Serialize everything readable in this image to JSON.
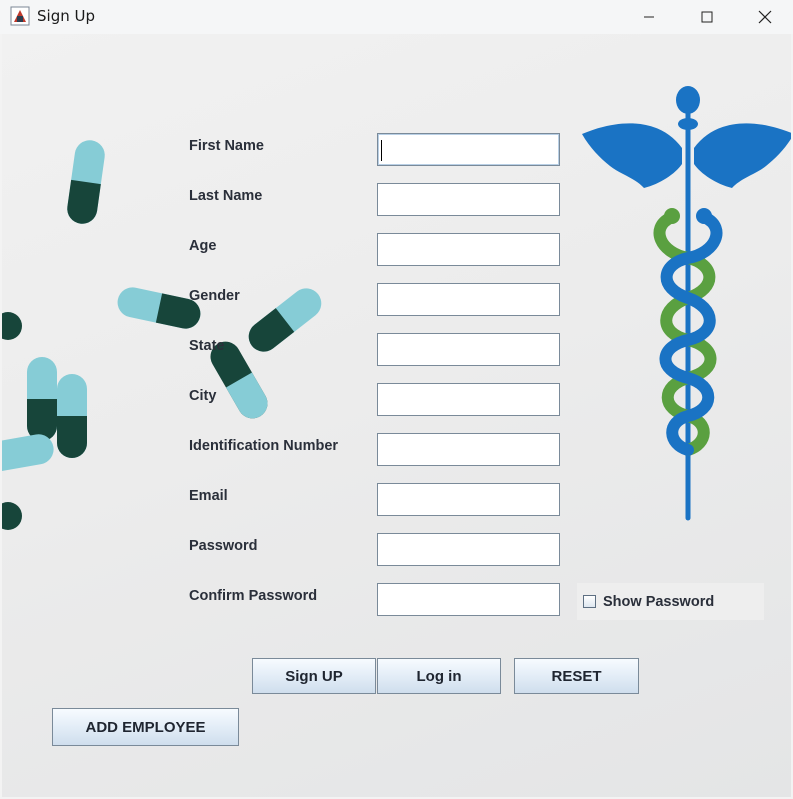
{
  "window": {
    "title": "Sign Up"
  },
  "form": {
    "fields": [
      {
        "label": "First Name",
        "value": ""
      },
      {
        "label": "Last Name",
        "value": ""
      },
      {
        "label": "Age",
        "value": ""
      },
      {
        "label": "Gender",
        "value": ""
      },
      {
        "label": "State",
        "value": ""
      },
      {
        "label": "City",
        "value": ""
      },
      {
        "label": "Identification Number",
        "value": ""
      },
      {
        "label": "Email",
        "value": ""
      },
      {
        "label": "Password",
        "value": ""
      },
      {
        "label": "Confirm Password",
        "value": ""
      }
    ],
    "show_password_label": "Show Password",
    "show_password_checked": false
  },
  "buttons": {
    "signup": "Sign UP",
    "login": "Log in",
    "reset": "RESET",
    "add_employee": "ADD EMPLOYEE"
  },
  "colors": {
    "caduceus_blue": "#1a73c4",
    "caduceus_green": "#5aa040",
    "pill_cyan": "#86ccd6",
    "pill_dark": "#17453a"
  }
}
